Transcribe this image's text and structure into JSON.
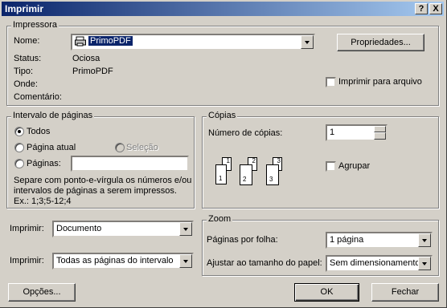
{
  "window": {
    "title": "Imprimir"
  },
  "titlebar": {
    "help": "?",
    "close": "X"
  },
  "printer": {
    "legend": "Impressora",
    "name_label": "Nome:",
    "name_value": "PrimoPDF",
    "properties_button": "Propriedades...",
    "status_label": "Status:",
    "status_value": "Ociosa",
    "type_label": "Tipo:",
    "type_value": "PrimoPDF",
    "where_label": "Onde:",
    "comment_label": "Comentário:",
    "print_to_file": "Imprimir para arquivo"
  },
  "range": {
    "legend": "Intervalo de páginas",
    "all": "Todos",
    "current": "Página atual",
    "selection": "Seleção",
    "pages": "Páginas:",
    "hint_line1": "Separe com ponto-e-vírgula os números e/ou",
    "hint_line2": "intervalos de páginas a serem impressos.",
    "hint_line3": "Ex.: 1;3;5-12;4"
  },
  "copies": {
    "legend": "Cópias",
    "number_label": "Número de cópias:",
    "number_value": "1",
    "collate": "Agrupar",
    "page_labels": [
      "1",
      "2",
      "3"
    ]
  },
  "print_what": {
    "label": "Imprimir:",
    "value": "Documento"
  },
  "print_range": {
    "label": "Imprimir:",
    "value": "Todas as páginas do intervalo"
  },
  "zoom": {
    "legend": "Zoom",
    "pages_per_sheet_label": "Páginas por folha:",
    "pages_per_sheet_value": "1 página",
    "scale_label": "Ajustar ao tamanho do papel:",
    "scale_value": "Sem dimensionamento"
  },
  "buttons": {
    "options": "Opções...",
    "ok": "OK",
    "close": "Fechar"
  }
}
